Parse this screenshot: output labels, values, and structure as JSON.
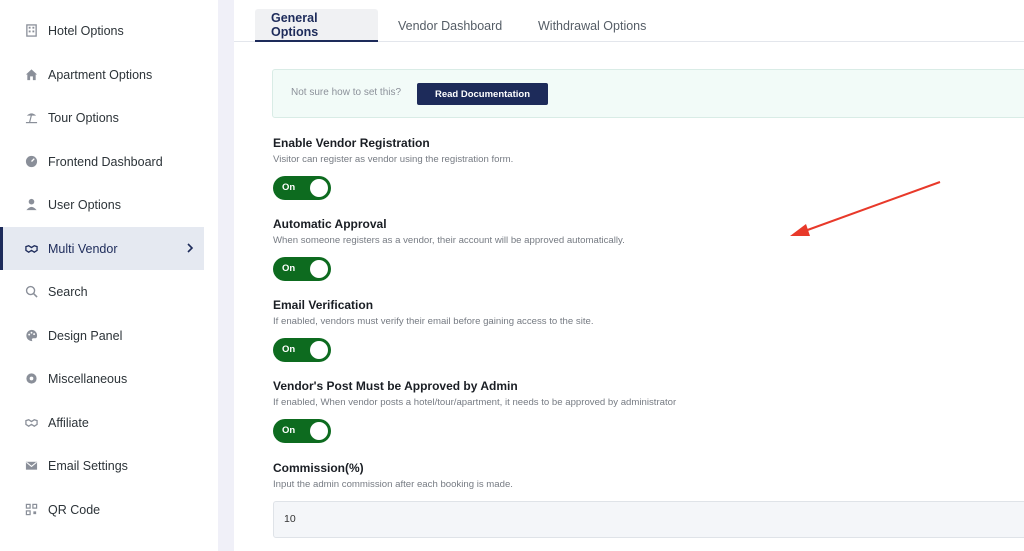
{
  "sidebar": {
    "items": [
      {
        "label": "Hotel Options",
        "icon": "hotel-icon"
      },
      {
        "label": "Apartment Options",
        "icon": "home-icon"
      },
      {
        "label": "Tour Options",
        "icon": "beach-icon"
      },
      {
        "label": "Frontend Dashboard",
        "icon": "dashboard-icon"
      },
      {
        "label": "User Options",
        "icon": "user-icon"
      },
      {
        "label": "Multi Vendor",
        "icon": "handshake-icon",
        "active": true
      },
      {
        "label": "Search",
        "icon": "search-icon"
      },
      {
        "label": "Design Panel",
        "icon": "palette-icon"
      },
      {
        "label": "Miscellaneous",
        "icon": "gear-icon"
      },
      {
        "label": "Affiliate",
        "icon": "handshake-icon"
      },
      {
        "label": "Email Settings",
        "icon": "envelope-icon"
      },
      {
        "label": "QR Code",
        "icon": "qr-icon"
      }
    ]
  },
  "tabs": [
    {
      "label": "General Options",
      "active": true
    },
    {
      "label": "Vendor Dashboard"
    },
    {
      "label": "Withdrawal Options"
    }
  ],
  "doc": {
    "hint": "Not sure how to set this?",
    "button": "Read Documentation"
  },
  "fields": [
    {
      "label": "Enable Vendor Registration",
      "desc": "Visitor can register as vendor using the registration form.",
      "toggle": "On"
    },
    {
      "label": "Automatic Approval",
      "desc": "When someone registers as a vendor, their account will be approved automatically.",
      "toggle": "On"
    },
    {
      "label": "Email Verification",
      "desc": "If enabled, vendors must verify their email before gaining access to the site.",
      "toggle": "On"
    },
    {
      "label": "Vendor's Post Must be Approved by Admin",
      "desc": "If enabled, When vendor posts a hotel/tour/apartment, it needs to be approved by administrator",
      "toggle": "On"
    }
  ],
  "commission": {
    "label": "Commission(%)",
    "desc": "Input the admin commission after each booking is made.",
    "value": "10"
  },
  "colors": {
    "accent": "#1d2b5a",
    "toggle_on": "#0d6b1f",
    "annotation_arrow": "#e8392a"
  }
}
